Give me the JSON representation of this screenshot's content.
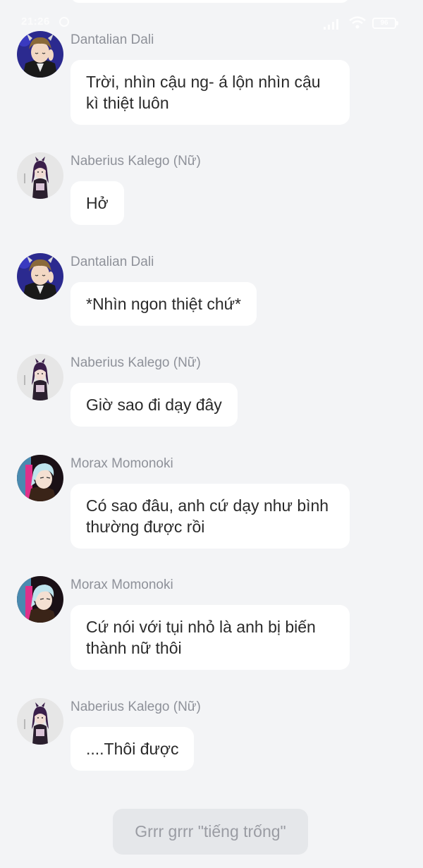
{
  "status_bar": {
    "time": "21:26",
    "battery": "96"
  },
  "messages": [
    {
      "sender": "Dantalian Dali",
      "avatar_icon": "dantalian-avatar-icon",
      "text": "Trời, nhìn cậu ng- á lộn nhìn cậu kì thiệt luôn"
    },
    {
      "sender": "Naberius Kalego (Nữ)",
      "avatar_icon": "kalego-avatar-icon",
      "text": "Hở"
    },
    {
      "sender": "Dantalian Dali",
      "avatar_icon": "dantalian-avatar-icon",
      "text": "*Nhìn ngon thiệt chứ*"
    },
    {
      "sender": "Naberius Kalego (Nữ)",
      "avatar_icon": "kalego-avatar-icon",
      "text": "Giờ sao đi dạy đây"
    },
    {
      "sender": "Morax Momonoki",
      "avatar_icon": "momonoki-avatar-icon",
      "text": "Có sao đâu, anh cứ dạy như bình thường được rồi"
    },
    {
      "sender": "Morax Momonoki",
      "avatar_icon": "momonoki-avatar-icon",
      "text": "Cứ nói với tụi nhỏ là anh bị biến thành nữ thôi"
    },
    {
      "sender": "Naberius Kalego (Nữ)",
      "avatar_icon": "kalego-avatar-icon",
      "text": "....Thôi được"
    }
  ],
  "narration": {
    "text": "Grrr grrr \"tiếng trống\""
  },
  "colors": {
    "background": "#f3f4f6",
    "bubble": "#ffffff",
    "sender_name": "#8e9199",
    "message_text": "#2a2a2a",
    "narration_bg": "#e5e7ea",
    "narration_text": "#9a9ca3"
  }
}
